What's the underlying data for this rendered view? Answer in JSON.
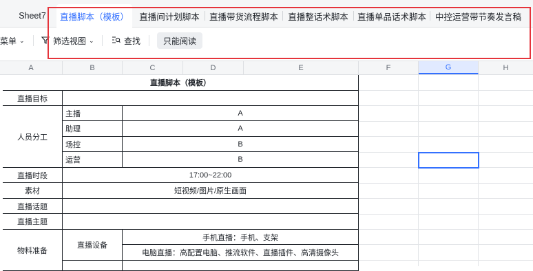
{
  "tabs": [
    {
      "label": "Sheet7"
    },
    {
      "label": "直播脚本（模板）",
      "active": true
    },
    {
      "label": "直播间计划脚本"
    },
    {
      "label": "直播带货流程脚本"
    },
    {
      "label": "直播整话术脚本"
    },
    {
      "label": "直播单品话术脚本"
    },
    {
      "label": "中控运营带节奏发言稿"
    }
  ],
  "toolbar": {
    "menu_label": "菜单",
    "filter_view_label": "筛选视图",
    "find_label": "查找",
    "readonly_label": "只能阅读"
  },
  "columns": [
    "A",
    "B",
    "C",
    "D",
    "E",
    "F",
    "G",
    "H"
  ],
  "selected_column": "G",
  "table": {
    "title": "直播脚本（模板）",
    "goal_label": "直播目标",
    "staff_label": "人员分工",
    "roles": [
      {
        "role": "主播",
        "person": "A"
      },
      {
        "role": "助理",
        "person": "A"
      },
      {
        "role": "场控",
        "person": "B"
      },
      {
        "role": "运营",
        "person": "B"
      }
    ],
    "time_label": "直播时段",
    "time_value": "17:00~22:00",
    "material_label": "素材",
    "material_value": "短视频/图片/原生画面",
    "topic_label": "直播话题",
    "theme_label": "直播主题",
    "supplies_label": "物料准备",
    "equipment_label": "直播设备",
    "equipment_items": [
      "手机直播：手机、支架",
      "电脑直播：高配置电脑、推流软件、直播插件、高清摄像头"
    ]
  }
}
